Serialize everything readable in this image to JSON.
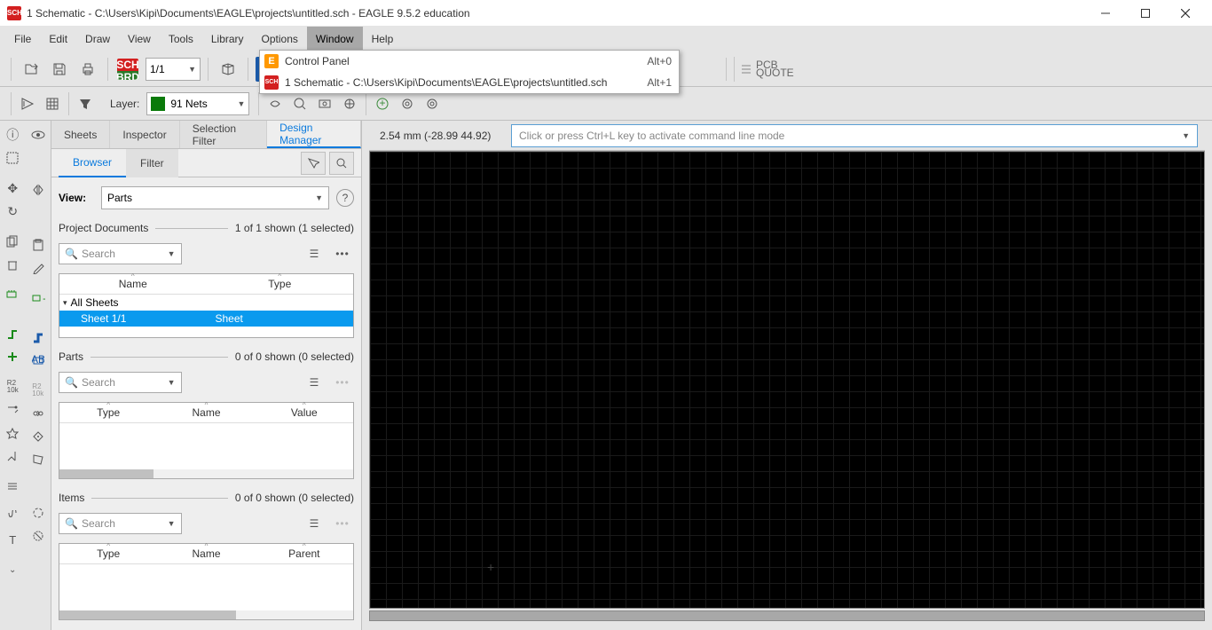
{
  "title": "1 Schematic - C:\\Users\\Kipi\\Documents\\EAGLE\\projects\\untitled.sch - EAGLE 9.5.2 education",
  "menu": {
    "items": [
      "File",
      "Edit",
      "Draw",
      "View",
      "Tools",
      "Library",
      "Options",
      "Window",
      "Help"
    ],
    "active": "Window"
  },
  "windowMenu": {
    "items": [
      {
        "icon": "E",
        "label": "Control Panel",
        "shortcut": "Alt+0"
      },
      {
        "icon": "SCH",
        "label": "1 Schematic - C:\\Users\\Kipi\\Documents\\EAGLE\\projects\\untitled.sch",
        "shortcut": "Alt+1"
      }
    ]
  },
  "toolbar1": {
    "sheet": "1/1",
    "pcbQuote1": "PCB",
    "pcbQuote2": "QUOTE"
  },
  "toolbar2": {
    "layerLabel": "Layer:",
    "layerValue": "91 Nets"
  },
  "cmdbar": {
    "coords": "2.54 mm (-28.99 44.92)",
    "placeholder": "Click or press Ctrl+L key to activate command line mode"
  },
  "panelTabs1": [
    "Sheets",
    "Inspector",
    "Selection Filter",
    "Design Manager"
  ],
  "panelTabs1Active": "Design Manager",
  "panelTabs2": [
    "Browser",
    "Filter"
  ],
  "panelTabs2Active": "Browser",
  "viewRow": {
    "label": "View:",
    "value": "Parts"
  },
  "sections": {
    "projectDocs": {
      "label": "Project Documents",
      "count": "1 of 1 shown (1 selected)",
      "searchPlaceholder": "Search",
      "headers": [
        "Name",
        "Type"
      ],
      "rows": [
        {
          "name": "All Sheets",
          "type": "",
          "tree": true
        },
        {
          "name": "Sheet 1/1",
          "type": "Sheet",
          "selected": true,
          "indent": true
        }
      ]
    },
    "parts": {
      "label": "Parts",
      "count": "0 of 0 shown (0 selected)",
      "searchPlaceholder": "Search",
      "headers": [
        "Type",
        "Name",
        "Value"
      ]
    },
    "items": {
      "label": "Items",
      "count": "0 of 0 shown (0 selected)",
      "searchPlaceholder": "Search",
      "headers": [
        "Type",
        "Name",
        "Parent"
      ]
    }
  }
}
